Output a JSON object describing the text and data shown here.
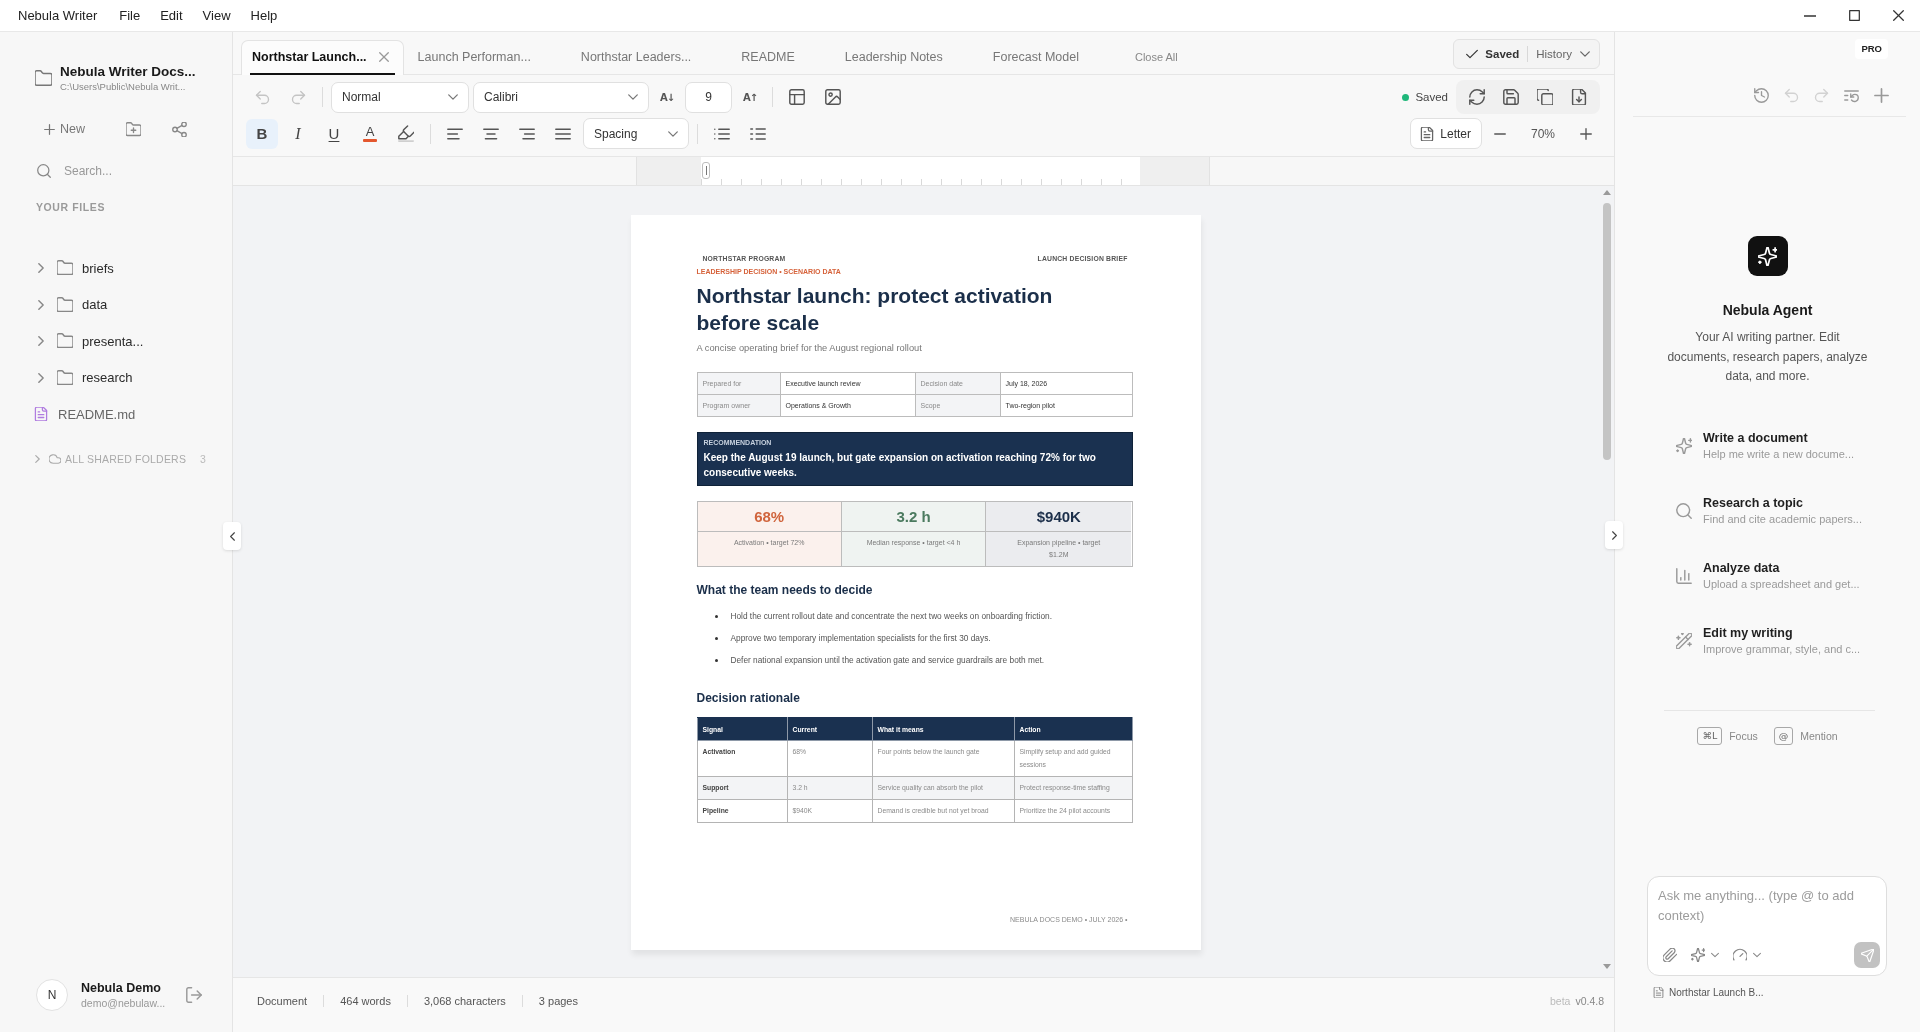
{
  "menu_bar": {
    "app_name": "Nebula Writer",
    "items": [
      "File",
      "Edit",
      "View",
      "Help"
    ]
  },
  "sidebar": {
    "workspace": {
      "title": "Nebula Writer Docs...",
      "path": "C:\\Users\\Public\\Nebula Writ..."
    },
    "new_label": "New",
    "search": {
      "placeholder": "Search..."
    },
    "section_label": "YOUR FILES",
    "files": [
      {
        "kind": "folder",
        "name": "briefs",
        "expanded": false
      },
      {
        "kind": "folder",
        "name": "data",
        "expanded": false
      },
      {
        "kind": "folder",
        "name": "presenta...",
        "expanded": false
      },
      {
        "kind": "folder",
        "name": "research",
        "expanded": false
      },
      {
        "kind": "file",
        "name": "README.md"
      }
    ],
    "shared_folders": {
      "label": "ALL SHARED FOLDERS",
      "count": "3",
      "expanded": false
    },
    "user": {
      "initial": "N",
      "name": "Nebula Demo",
      "email": "demo@nebulaw..."
    }
  },
  "tabs": [
    {
      "label": "Northstar Launch...",
      "selected": true
    },
    {
      "label": "Launch Performan...",
      "selected": false
    },
    {
      "label": "Northstar Leaders...",
      "selected": false
    },
    {
      "label": "README",
      "selected": false
    },
    {
      "label": "Leadership Notes",
      "selected": false
    },
    {
      "label": "Forecast Model",
      "selected": false
    }
  ],
  "close_all_label": "Close All",
  "save_menu": {
    "status": "Saved",
    "history_label": "History"
  },
  "toolbar": {
    "history": [
      {
        "kind": "undo",
        "disabled": true
      },
      {
        "kind": "redo",
        "disabled": true
      }
    ],
    "paragraph_style": "Normal",
    "font_family": "Calibri",
    "font_size": {
      "decrease_label": "A↓",
      "value": "9",
      "increase_label": "A↑"
    },
    "marks": [
      {
        "kind": "bold",
        "label": "B",
        "on": true
      },
      {
        "kind": "italic",
        "label": "I",
        "on": false
      },
      {
        "kind": "underline",
        "label": "U",
        "on": false
      }
    ],
    "text_color_label": "A",
    "spacing_label": "Spacing",
    "save_status": "Saved",
    "page_size": "Letter",
    "zoom": "70%"
  },
  "document": {
    "header_left": "NORTHSTAR PROGRAM",
    "header_right": "LAUNCH DECISION BRIEF",
    "eyebrow": "LEADERSHIP DECISION • SCENARIO DATA",
    "title": "Northstar launch: protect activation before scale",
    "subtitle": "A concise operating brief for the August regional rollout",
    "meta_table": [
      [
        "Prepared for",
        "Executive launch review",
        "Decision date",
        "July 18, 2026"
      ],
      [
        "Program owner",
        "Operations & Growth",
        "Scope",
        "Two-region pilot"
      ]
    ],
    "recommendation": {
      "label": "RECOMMENDATION",
      "text": "Keep the August 19 launch, but gate expansion on activation reaching 72% for two consecutive weeks."
    },
    "kpis": [
      {
        "value": "68%",
        "caption": "Activation • target 72%",
        "color": "#d0643c"
      },
      {
        "value": "3.2 h",
        "caption": "Median response • target <4 h",
        "color": "#4b7a5f"
      },
      {
        "value": "$940K",
        "caption": "Expansion pipeline • target $1.2M",
        "color": "#1c2f4a"
      }
    ],
    "decide": {
      "heading": "What the team needs to decide",
      "bullets": [
        "Hold the current rollout date and concentrate the next two weeks on onboarding friction.",
        "Approve two temporary implementation specialists for the first 30 days.",
        "Defer national expansion until the activation gate and service guardrails are both met."
      ]
    },
    "rationale": {
      "heading": "Decision rationale",
      "columns": [
        "Signal",
        "Current",
        "What it means",
        "Action"
      ],
      "rows": [
        [
          "Activation",
          "68%",
          "Four points below the launch gate",
          "Simplify setup and add guided sessions"
        ],
        [
          "Support",
          "3.2 h",
          "Service quality can absorb the pilot",
          "Protect response-time staffing"
        ],
        [
          "Pipeline",
          "$940K",
          "Demand is credible but not yet broad",
          "Prioritize the 24 pilot accounts"
        ]
      ]
    },
    "footer": "NEBULA DOCS DEMO • JULY 2026 •"
  },
  "status_bar": {
    "items": [
      "Document",
      "464 words",
      "3,068 characters",
      "3 pages"
    ],
    "channel": "beta",
    "version": "v0.4.8"
  },
  "agent_panel": {
    "badge": "PRO",
    "toolbar": [
      {
        "kind": "history",
        "disabled": false
      },
      {
        "kind": "undo",
        "disabled": true
      },
      {
        "kind": "redo",
        "disabled": true
      },
      {
        "kind": "queue",
        "disabled": false
      },
      {
        "kind": "new",
        "disabled": false
      }
    ],
    "title": "Nebula Agent",
    "description": "Your AI writing partner. Edit documents, research papers, analyze data, and more.",
    "suggestions": [
      {
        "kind": "write",
        "title": "Write a document",
        "subtitle": "Help me write a new docume..."
      },
      {
        "kind": "research",
        "title": "Research a topic",
        "subtitle": "Find and cite academic papers..."
      },
      {
        "kind": "analyze",
        "title": "Analyze data",
        "subtitle": "Upload a spreadsheet and get..."
      },
      {
        "kind": "edit",
        "title": "Edit my writing",
        "subtitle": "Improve grammar, style, and c..."
      }
    ],
    "shortcuts": [
      {
        "key": "⌘L",
        "label": "Focus"
      },
      {
        "key": "@",
        "label": "Mention"
      }
    ],
    "composer": {
      "placeholder": "Ask me anything... (type @ to add context)",
      "send_disabled": true
    },
    "attachment": "Northstar Launch B..."
  }
}
